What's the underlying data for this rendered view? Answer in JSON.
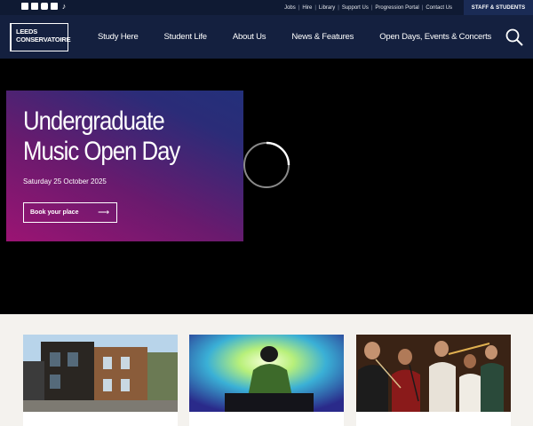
{
  "utility": {
    "social_icons": [
      "linkedin-icon",
      "facebook-icon",
      "instagram-icon",
      "youtube-icon",
      "tiktok-icon"
    ],
    "links": [
      "Jobs",
      "Hire",
      "Library",
      "Support Us",
      "Progression Portal",
      "Contact Us"
    ],
    "staff_label": "STAFF & STUDENTS"
  },
  "nav": {
    "logo_line1": "LEEDS",
    "logo_line2": "CONSERVATOIRE",
    "items": [
      "Study Here",
      "Student Life",
      "About Us",
      "News & Features",
      "Open Days, Events & Concerts"
    ],
    "search_icon": "search-icon"
  },
  "hero": {
    "title": "Undergraduate Music Open Day",
    "date": "Saturday 25 October 2025",
    "button_label": "Book your place",
    "button_icon": "arrow-right-icon",
    "loading": "spinner-icon"
  },
  "colors": {
    "utility_bg": "#0f1a33",
    "nav_bg": "#14203f",
    "staff_bg": "#1a2b55",
    "promo_gradient_start": "#9b1473",
    "promo_gradient_end": "#23307a",
    "cards_bg": "#f4f2ee"
  },
  "cards": [
    {
      "image": "building-photo"
    },
    {
      "image": "dj-performer-photo"
    },
    {
      "image": "woodwind-ensemble-photo"
    }
  ]
}
